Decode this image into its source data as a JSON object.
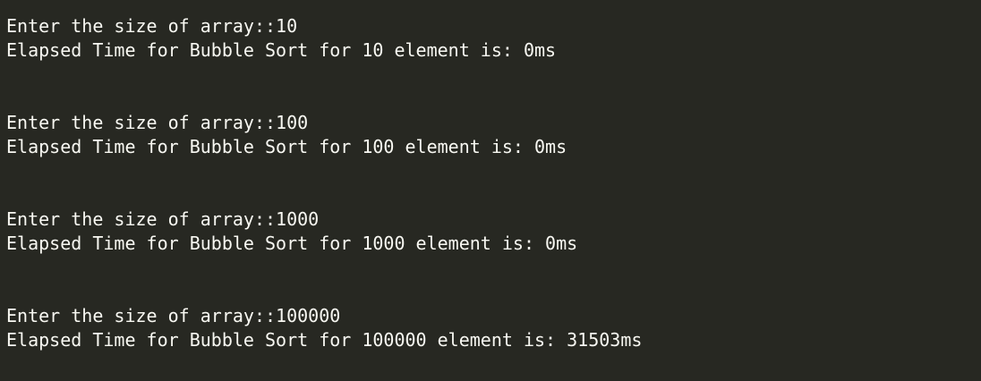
{
  "terminal": {
    "blocks": [
      {
        "prompt": "Enter the size of array::10",
        "result": "Elapsed Time for Bubble Sort for 10 element is: 0ms"
      },
      {
        "prompt": "Enter the size of array::100",
        "result": "Elapsed Time for Bubble Sort for 100 element is: 0ms"
      },
      {
        "prompt": "Enter the size of array::1000",
        "result": "Elapsed Time for Bubble Sort for 1000 element is: 0ms"
      },
      {
        "prompt": "Enter the size of array::100000",
        "result": "Elapsed Time for Bubble Sort for 100000 element is: 31503ms"
      }
    ]
  },
  "colors": {
    "background": "#272822",
    "text": "#f8f8f2"
  }
}
